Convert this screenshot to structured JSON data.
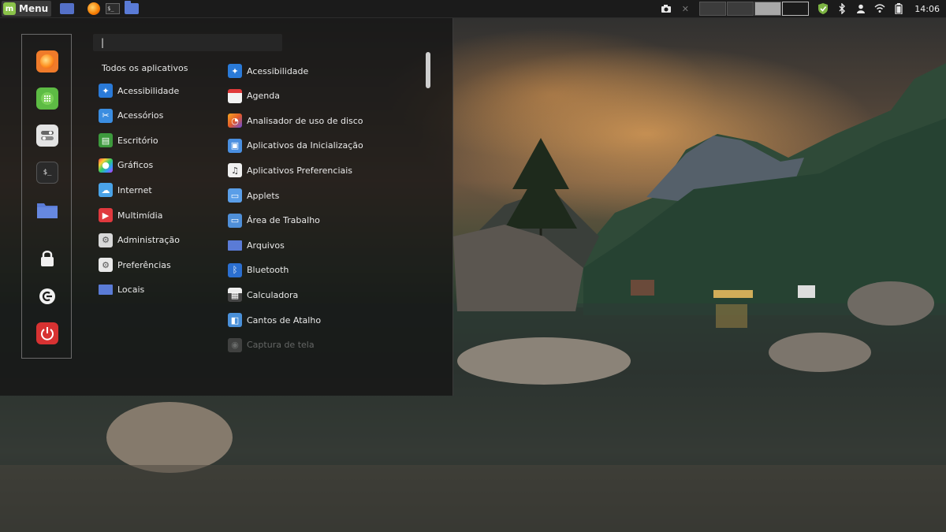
{
  "panel": {
    "menu_label": "Menu",
    "clock": "14:06",
    "launchers": [
      "show-desktop-icon",
      "firefox-icon",
      "terminal-icon",
      "files-icon"
    ],
    "tray": [
      "screenshot-icon",
      "close-icon",
      "workspace-1",
      "workspace-2",
      "workspace-3",
      "workspace-4",
      "shield-icon",
      "bluetooth-icon",
      "user-icon",
      "wifi-icon",
      "battery-icon"
    ]
  },
  "search": {
    "value": ""
  },
  "favorites": [
    "firefox-icon",
    "software-manager-icon",
    "settings-icon",
    "terminal-icon",
    "files-icon",
    "lock-icon",
    "logout-icon",
    "power-icon"
  ],
  "categories": {
    "header": "Todos os aplicativos",
    "items": [
      {
        "label": "Acessibilidade",
        "icon": "accessibility-icon",
        "color": "#2a7ad8"
      },
      {
        "label": "Acessórios",
        "icon": "accessories-icon",
        "color": "#3b8de0"
      },
      {
        "label": "Escritório",
        "icon": "office-icon",
        "color": "#3d9a3d"
      },
      {
        "label": "Gráficos",
        "icon": "graphics-icon",
        "color": "#d34fb0"
      },
      {
        "label": "Internet",
        "icon": "internet-icon",
        "color": "#4aa3e8"
      },
      {
        "label": "Multimídia",
        "icon": "multimedia-icon",
        "color": "#e0393e"
      },
      {
        "label": "Administração",
        "icon": "administration-icon",
        "color": "#d8d8d8"
      },
      {
        "label": "Preferências",
        "icon": "preferences-icon",
        "color": "#e8e8e8"
      },
      {
        "label": "Locais",
        "icon": "places-icon",
        "color": "#5a7bd6"
      }
    ]
  },
  "apps": [
    {
      "label": "Acessibilidade",
      "icon": "accessibility-icon",
      "color": "#2a7ad8"
    },
    {
      "label": "Agenda",
      "icon": "calendar-icon",
      "color": "#f2f2f2"
    },
    {
      "label": "Analisador de uso de disco",
      "icon": "disk-usage-icon",
      "color": "#f08a24"
    },
    {
      "label": "Aplicativos da Inicialização",
      "icon": "startup-apps-icon",
      "color": "#4a8fe0"
    },
    {
      "label": "Aplicativos Preferenciais",
      "icon": "preferred-apps-icon",
      "color": "#f0f0f0"
    },
    {
      "label": "Applets",
      "icon": "applets-icon",
      "color": "#5a9ee8"
    },
    {
      "label": "Área de Trabalho",
      "icon": "desktop-icon",
      "color": "#4f8fd8"
    },
    {
      "label": "Arquivos",
      "icon": "files-icon",
      "color": "#5a7bd6"
    },
    {
      "label": "Bluetooth",
      "icon": "bluetooth-icon",
      "color": "#2b6fd0"
    },
    {
      "label": "Calculadora",
      "icon": "calculator-icon",
      "color": "#555555"
    },
    {
      "label": "Cantos de Atalho",
      "icon": "hot-corners-icon",
      "color": "#4a90d9"
    },
    {
      "label": "Captura de tela",
      "icon": "screenshot-icon",
      "color": "#888888"
    }
  ]
}
